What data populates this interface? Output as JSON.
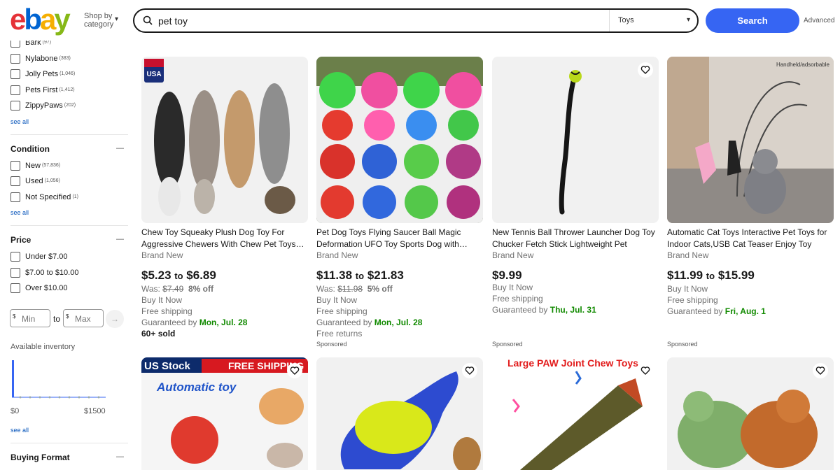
{
  "header": {
    "logo_letters": [
      "e",
      "b",
      "a",
      "y"
    ],
    "shop_by_line1": "Shop by",
    "shop_by_line2": "category",
    "search_value": "pet toy",
    "category": "Toys",
    "search_button": "Search",
    "advanced": "Advanced",
    "colors": {
      "logo_red": "#e53238",
      "logo_blue": "#0064d2",
      "logo_yellow": "#f5af02",
      "logo_green": "#86b817",
      "search_button": "#3665f3"
    }
  },
  "sidebar": {
    "brands": [
      {
        "label": "Bark",
        "count": "(97)"
      },
      {
        "label": "Nylabone",
        "count": "(383)"
      },
      {
        "label": "Jolly Pets",
        "count": "(1,046)"
      },
      {
        "label": "Pets First",
        "count": "(1,412)"
      },
      {
        "label": "ZippyPaws",
        "count": "(202)"
      }
    ],
    "see_all": "see all",
    "condition_title": "Condition",
    "conditions": [
      {
        "label": "New",
        "count": "(57,836)"
      },
      {
        "label": "Used",
        "count": "(1,056)"
      },
      {
        "label": "Not Specified",
        "count": "(1)"
      }
    ],
    "price_title": "Price",
    "prices": [
      {
        "label": "Under $7.00"
      },
      {
        "label": "$7.00 to $10.00"
      },
      {
        "label": "Over $10.00"
      }
    ],
    "currency_symbol": "$",
    "min_placeholder": "Min",
    "max_placeholder": "Max",
    "to_label": "to",
    "inventory_label": "Available inventory",
    "range_min": "$0",
    "range_max": "$1500",
    "buying_format_title": "Buying Format"
  },
  "products": [
    {
      "title": "Chew Toy Squeaky Plush Dog Toy For Aggressive Chewers With Chew Pet Toys…",
      "condition": "Brand New",
      "price_low": "$5.23",
      "price_to": "to",
      "price_high": "$6.89",
      "was_label": "Was:",
      "was_price": "$7.49",
      "discount": "8% off",
      "buy_it_now": "Buy It Now",
      "shipping": "Free shipping",
      "guaranteed_label": "Guaranteed by",
      "guaranteed_date": "Mon, Jul. 28",
      "sold": "60+ sold",
      "image": "plush-squirrel-toys"
    },
    {
      "title": "Pet Dog Toys Flying Saucer Ball Magic Deformation UFO Toy Sports Dog with…",
      "condition": "Brand New",
      "price_low": "$11.38",
      "price_to": "to",
      "price_high": "$21.83",
      "was_label": "Was:",
      "was_price": "$11.98",
      "discount": "5% off",
      "buy_it_now": "Buy It Now",
      "shipping": "Free shipping",
      "guaranteed_label": "Guaranteed by",
      "guaranteed_date": "Mon, Jul. 28",
      "returns": "Free returns",
      "sponsored": "Sponsored",
      "image": "ufo-balls"
    },
    {
      "title": "New Tennis Ball Thrower Launcher Dog Toy Chucker Fetch Stick Lightweight Pet",
      "condition": "Brand New",
      "price": "$9.99",
      "buy_it_now": "Buy It Now",
      "shipping": "Free shipping",
      "guaranteed_label": "Guaranteed by",
      "guaranteed_date": "Thu, Jul. 31",
      "sponsored": "Sponsored",
      "image": "ball-launcher"
    },
    {
      "title": "Automatic Cat Toys Interactive Pet Toys for Indoor Cats,USB Cat Teaser Enjoy Toy",
      "condition": "Brand New",
      "price_low": "$11.99",
      "price_to": "to",
      "price_high": "$15.99",
      "buy_it_now": "Buy It Now",
      "shipping": "Free shipping",
      "guaranteed_label": "Guaranteed by",
      "guaranteed_date": "Fri, Aug. 1",
      "sponsored": "Sponsored",
      "image_caption": "Handheld/adsorbable",
      "image": "cat-teaser"
    }
  ],
  "row2": [
    {
      "banner_left": "US Stock",
      "banner_right": "FREE SHIPPING",
      "subtitle": "Automatic toy",
      "image": "automatic-ball"
    },
    {
      "image": "dino-chew-toy"
    },
    {
      "banner": "Large PAW Joint Chew Toys",
      "image": "joint-chew-toy"
    },
    {
      "image": "plush-animals"
    }
  ],
  "usa_badge": "USA"
}
